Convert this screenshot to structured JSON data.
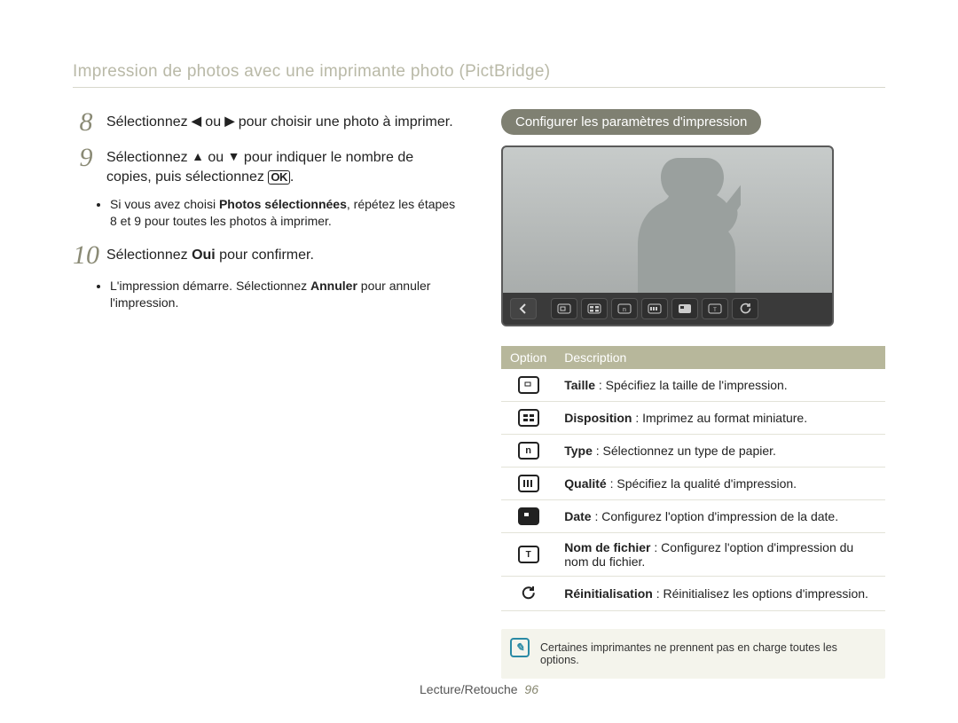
{
  "title": "Impression de photos avec une imprimante photo (PictBridge)",
  "steps": {
    "s8_num": "8",
    "s8_pre": "Sélectionnez ",
    "s8_mid": " ou ",
    "s8_post": " pour choisir une photo à imprimer.",
    "s9_num": "9",
    "s9_pre": "Sélectionnez ",
    "s9_mid": " ou ",
    "s9_post1": " pour indiquer le nombre de copies, puis sélectionnez ",
    "s9_ok": "OK",
    "s9_post2": ".",
    "s9_sub_a": "Si vous avez choisi ",
    "s9_sub_b": "Photos sélectionnées",
    "s9_sub_c": ", répétez les étapes 8 et 9 pour toutes les photos à imprimer.",
    "s10_num": "10",
    "s10_pre": "Sélectionnez ",
    "s10_b": "Oui",
    "s10_post": " pour confirmer.",
    "s10_sub_a": "L'impression démarre. Sélectionnez ",
    "s10_sub_b": "Annuler",
    "s10_sub_c": " pour annuler l'impression."
  },
  "config_heading": "Configurer les paramètres d'impression",
  "toolbar_icons": [
    "back-icon",
    "size-icon",
    "layout-icon",
    "type-icon",
    "quality-icon",
    "date-icon",
    "filename-icon",
    "reset-icon"
  ],
  "table": {
    "head_option": "Option",
    "head_desc": "Description",
    "rows": [
      {
        "icon": "size",
        "label": "Taille",
        "desc": " : Spécifiez la taille de l'impression."
      },
      {
        "icon": "layout",
        "label": "Disposition",
        "desc": " : Imprimez au format miniature."
      },
      {
        "icon": "type",
        "label": "Type",
        "desc": " : Sélectionnez un type de papier."
      },
      {
        "icon": "quality",
        "label": "Qualité",
        "desc": " : Spécifiez la qualité d'impression."
      },
      {
        "icon": "date",
        "label": "Date",
        "desc": " : Configurez l'option d'impression de la date."
      },
      {
        "icon": "filename",
        "label": "Nom de fichier",
        "desc": " : Configurez l'option d'impression du nom du fichier."
      },
      {
        "icon": "reset",
        "label": "Réinitialisation",
        "desc": " : Réinitialisez les options d'impression."
      }
    ]
  },
  "note": "Certaines imprimantes ne prennent pas en charge toutes les options.",
  "footer_section": "Lecture/Retouche",
  "footer_page": "96"
}
